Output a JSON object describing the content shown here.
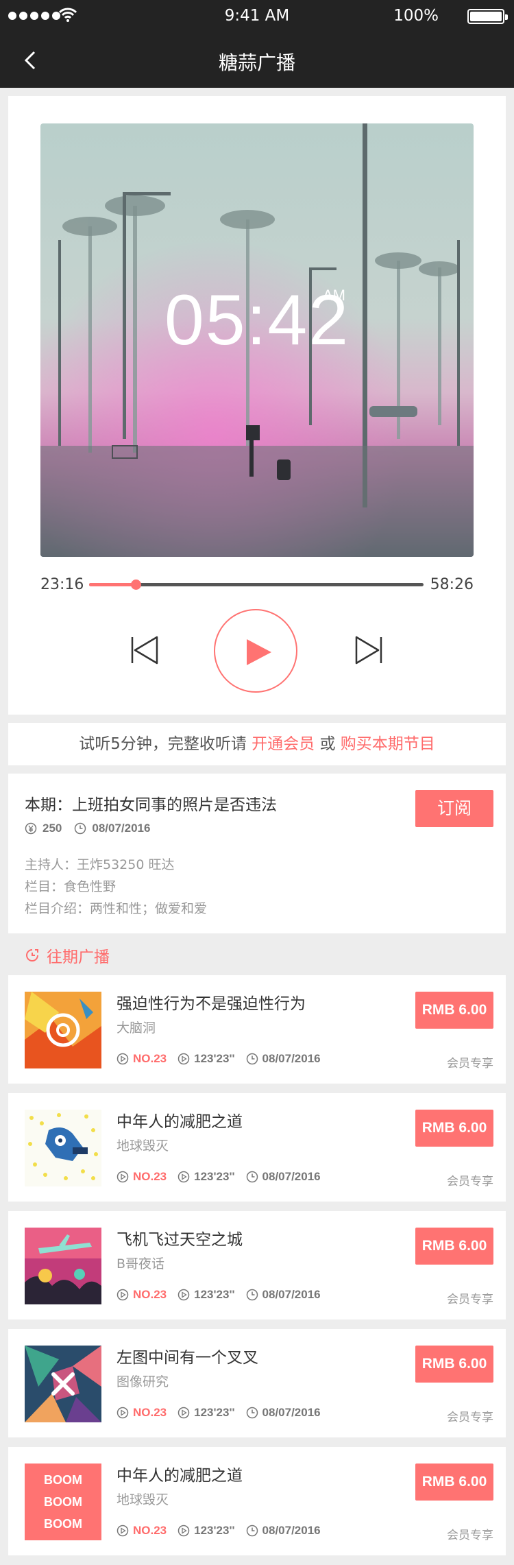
{
  "status_bar": {
    "time": "9:41 AM",
    "battery": "100%"
  },
  "nav": {
    "title": "糖蒜广播"
  },
  "player": {
    "cover_time": "05:42",
    "cover_ampm": "AM",
    "elapsed": "23:16",
    "total": "58:26",
    "progress": 0.14
  },
  "notice": {
    "prefix": "试听5分钟，完整收听请 ",
    "link1": "开通会员",
    "middle": " 或 ",
    "link2": "购买本期节目"
  },
  "episode": {
    "title": "本期：上班拍女同事的照片是否违法",
    "subscribe_label": "订阅",
    "price_count": "250",
    "date": "08/07/2016",
    "host": "主持人：王炸53250 旺达",
    "column": "栏目：食色性野",
    "column_intro": "栏目介绍：两性和性；做爱和爱"
  },
  "past": {
    "heading": "往期广播",
    "items": [
      {
        "title": "强迫性行为不是强迫性行为",
        "author": "大脑洞",
        "no": "NO.23",
        "duration": "123'23''",
        "date": "08/07/2016",
        "price": "RMB 6.00",
        "tag": "会员专享"
      },
      {
        "title": "中年人的减肥之道",
        "author": "地球毁灭",
        "no": "NO.23",
        "duration": "123'23''",
        "date": "08/07/2016",
        "price": "RMB 6.00",
        "tag": "会员专享"
      },
      {
        "title": "飞机飞过天空之城",
        "author": "B哥夜话",
        "no": "NO.23",
        "duration": "123'23''",
        "date": "08/07/2016",
        "price": "RMB 6.00",
        "tag": "会员专享"
      },
      {
        "title": "左图中间有一个叉叉",
        "author": "图像研究",
        "no": "NO.23",
        "duration": "123'23''",
        "date": "08/07/2016",
        "price": "RMB 6.00",
        "tag": "会员专享"
      },
      {
        "title": "中年人的减肥之道",
        "author": "地球毁灭",
        "no": "NO.23",
        "duration": "123'23''",
        "date": "08/07/2016",
        "price": "RMB 6.00",
        "tag": "会员专享",
        "thumb_text": [
          "BOOM",
          "BOOM",
          "BOOM"
        ]
      }
    ]
  },
  "colors": {
    "accent": "#ff7372",
    "nav_bg": "#232323",
    "page_bg": "#ededed"
  }
}
